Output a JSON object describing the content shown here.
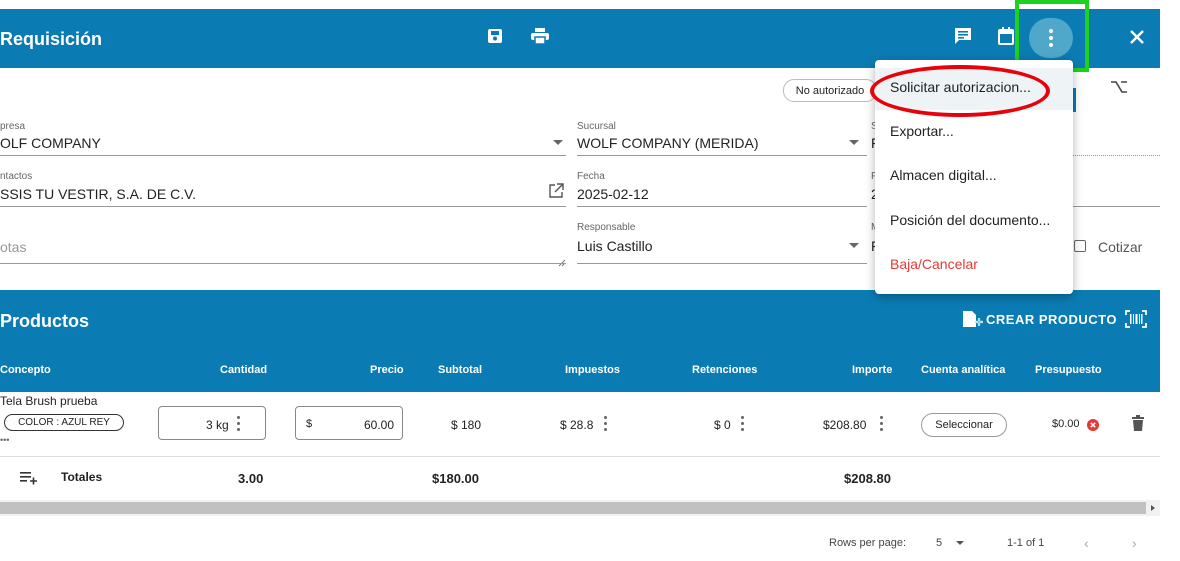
{
  "header": {
    "title": "Requisición",
    "icons": [
      "save-icon",
      "print-icon",
      "comment-icon",
      "calendar-icon",
      "more-vert-icon",
      "close-icon"
    ]
  },
  "status": {
    "badge": "No autorizado"
  },
  "form": {
    "empresa": {
      "label": "presa",
      "value": "OLF COMPANY"
    },
    "contactos": {
      "label": "ntactos",
      "value": "SSIS TU VESTIR, S.A. DE C.V."
    },
    "notas": {
      "placeholder": "otas"
    },
    "sucursal": {
      "label": "Sucursal",
      "value": "WOLF COMPANY (MERIDA)"
    },
    "fecha": {
      "label": "Fecha",
      "value": "2025-02-12"
    },
    "responsable": {
      "label": "Responsable",
      "value": "Luis Castillo"
    },
    "partial": {
      "s_label": "S",
      "s_value": "F",
      "f_label": "F",
      "f_value": "2",
      "m_label": "M",
      "m_value": "F"
    },
    "cotizar": "Cotizar"
  },
  "menu": {
    "items": [
      "Solicitar autorizacion...",
      "Exportar...",
      "Almacen digital...",
      "Posición del documento...",
      "Baja/Cancelar"
    ],
    "danger_color": "#e53935"
  },
  "products": {
    "title": "Productos",
    "create_label": "CREAR PRODUCTO",
    "columns": [
      "Concepto",
      "Cantidad",
      "Precio",
      "Subtotal",
      "Impuestos",
      "Retenciones",
      "Importe",
      "Cuenta analítica",
      "Presupuesto"
    ],
    "row": {
      "concepto": "Tela Brush prueba",
      "chip": "COLOR : AZUL REY",
      "more": "•••",
      "cantidad": "3 kg",
      "precio_symbol": "$",
      "precio": "60.00",
      "subtotal": "$ 180",
      "impuestos": "$ 28.8",
      "retenciones": "$ 0",
      "importe": "$208.80",
      "cuenta": "Seleccionar",
      "presupuesto": "$0.00"
    },
    "totals": {
      "label": "Totales",
      "cantidad": "3.00",
      "subtotal": "$180.00",
      "importe": "$208.80"
    }
  },
  "pagination": {
    "rows_label": "Rows per page:",
    "rows_value": "5",
    "range": "1-1 of 1"
  },
  "colors": {
    "primary": "#0b7cb3",
    "highlight_green": "#1fd11f",
    "highlight_red": "#e8000b"
  }
}
